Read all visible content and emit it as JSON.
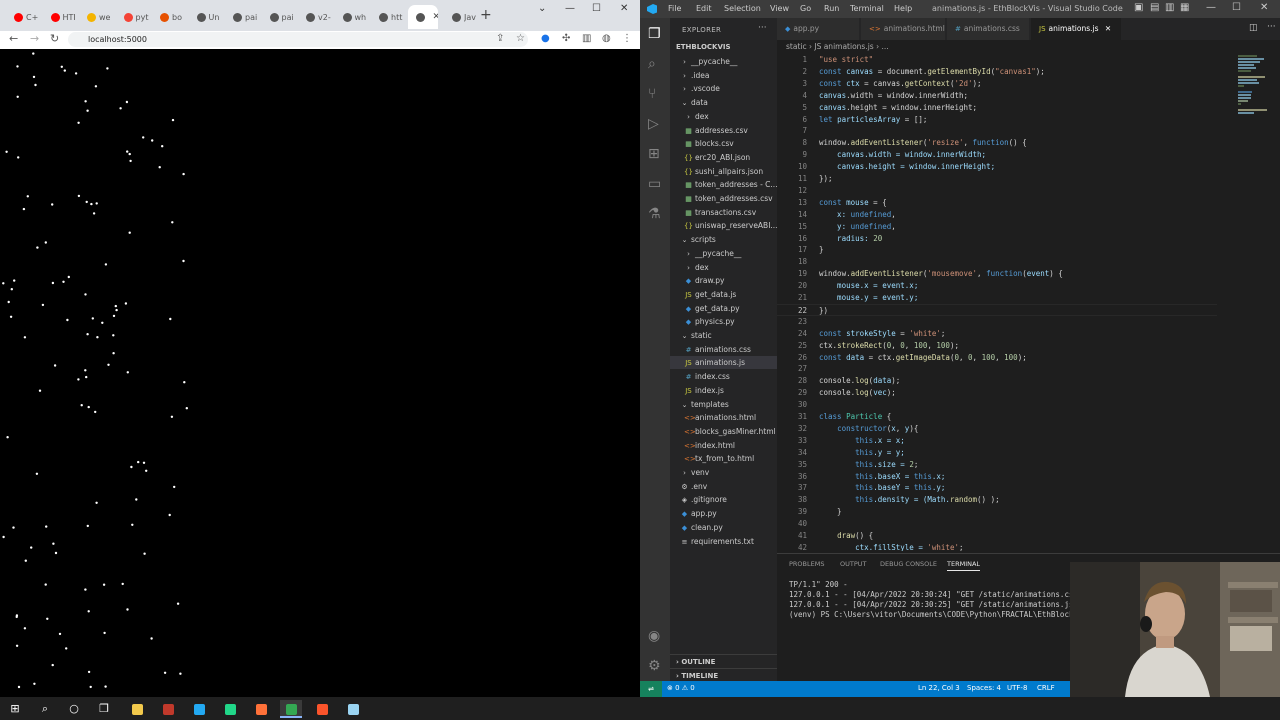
{
  "chrome": {
    "tabs": [
      {
        "label": "C+",
        "color": "#ff0000"
      },
      {
        "label": "HTI",
        "color": "#ff0000"
      },
      {
        "label": "we",
        "color": "#f4b400"
      },
      {
        "label": "pyt",
        "color": "#f44336"
      },
      {
        "label": "bo",
        "color": "#e65100"
      },
      {
        "label": "Un",
        "color": "#555555"
      },
      {
        "label": "pai",
        "color": "#555555"
      },
      {
        "label": "pai",
        "color": "#555555"
      },
      {
        "label": "v2-",
        "color": "#555555"
      },
      {
        "label": "wh",
        "color": "#555555"
      },
      {
        "label": "htt",
        "color": "#555555"
      },
      {
        "label": "",
        "color": "#555555"
      },
      {
        "label": "Jav",
        "color": "#555555"
      }
    ],
    "new_tab_label": "+",
    "url": "localhost:5000"
  },
  "vscode": {
    "menu": [
      "File",
      "Edit",
      "Selection",
      "View",
      "Go",
      "Run",
      "Terminal",
      "Help"
    ],
    "window_title": "animations.js - EthBlockVis - Visual Studio Code",
    "explorer_label": "EXPLORER",
    "root_folder": "ETHBLOCKVIS",
    "tree": [
      {
        "label": "__pycache__",
        "icon": "›",
        "depth": 1,
        "color": "#cccccc"
      },
      {
        "label": ".idea",
        "icon": "›",
        "depth": 1,
        "color": "#cccccc"
      },
      {
        "label": ".vscode",
        "icon": "›",
        "depth": 1,
        "color": "#cccccc"
      },
      {
        "label": "data",
        "icon": "⌄",
        "depth": 1,
        "color": "#cccccc"
      },
      {
        "label": "dex",
        "icon": "›",
        "depth": 2,
        "color": "#cccccc"
      },
      {
        "label": "addresses.csv",
        "icon": "▦",
        "depth": 2,
        "color": "#89d185"
      },
      {
        "label": "blocks.csv",
        "icon": "▦",
        "depth": 2,
        "color": "#89d185"
      },
      {
        "label": "erc20_ABI.json",
        "icon": "{}",
        "depth": 2,
        "color": "#cbcb41"
      },
      {
        "label": "sushi_allpairs.json",
        "icon": "{}",
        "depth": 2,
        "color": "#cbcb41"
      },
      {
        "label": "token_addresses - C...",
        "icon": "▦",
        "depth": 2,
        "color": "#89d185"
      },
      {
        "label": "token_addresses.csv",
        "icon": "▦",
        "depth": 2,
        "color": "#89d185"
      },
      {
        "label": "transactions.csv",
        "icon": "▦",
        "depth": 2,
        "color": "#89d185"
      },
      {
        "label": "uniswap_reserveABI...",
        "icon": "{}",
        "depth": 2,
        "color": "#cbcb41"
      },
      {
        "label": "scripts",
        "icon": "⌄",
        "depth": 1,
        "color": "#cccccc"
      },
      {
        "label": "__pycache__",
        "icon": "›",
        "depth": 2,
        "color": "#cccccc"
      },
      {
        "label": "dex",
        "icon": "›",
        "depth": 2,
        "color": "#cccccc"
      },
      {
        "label": "draw.py",
        "icon": "◆",
        "depth": 2,
        "color": "#3b8fd6"
      },
      {
        "label": "get_data.js",
        "icon": "JS",
        "depth": 2,
        "color": "#cbcb41"
      },
      {
        "label": "get_data.py",
        "icon": "◆",
        "depth": 2,
        "color": "#3b8fd6"
      },
      {
        "label": "physics.py",
        "icon": "◆",
        "depth": 2,
        "color": "#3b8fd6"
      },
      {
        "label": "static",
        "icon": "⌄",
        "depth": 1,
        "color": "#cccccc"
      },
      {
        "label": "animations.css",
        "icon": "#",
        "depth": 2,
        "color": "#519aba"
      },
      {
        "label": "animations.js",
        "icon": "JS",
        "depth": 2,
        "color": "#cbcb41",
        "selected": true
      },
      {
        "label": "index.css",
        "icon": "#",
        "depth": 2,
        "color": "#519aba"
      },
      {
        "label": "index.js",
        "icon": "JS",
        "depth": 2,
        "color": "#cbcb41"
      },
      {
        "label": "templates",
        "icon": "⌄",
        "depth": 1,
        "color": "#cccccc"
      },
      {
        "label": "animations.html",
        "icon": "<>",
        "depth": 2,
        "color": "#e37933"
      },
      {
        "label": "blocks_gasMiner.html",
        "icon": "<>",
        "depth": 2,
        "color": "#e37933"
      },
      {
        "label": "index.html",
        "icon": "<>",
        "depth": 2,
        "color": "#e37933"
      },
      {
        "label": "tx_from_to.html",
        "icon": "<>",
        "depth": 2,
        "color": "#e37933"
      },
      {
        "label": "venv",
        "icon": "›",
        "depth": 1,
        "color": "#cccccc"
      },
      {
        "label": ".env",
        "icon": "⚙",
        "depth": 1,
        "color": "#cccccc"
      },
      {
        "label": ".gitignore",
        "icon": "◈",
        "depth": 1,
        "color": "#cccccc"
      },
      {
        "label": "app.py",
        "icon": "◆",
        "depth": 1,
        "color": "#3b8fd6"
      },
      {
        "label": "clean.py",
        "icon": "◆",
        "depth": 1,
        "color": "#3b8fd6"
      },
      {
        "label": "requirements.txt",
        "icon": "≡",
        "depth": 1,
        "color": "#cccccc"
      }
    ],
    "outline_label": "OUTLINE",
    "timeline_label": "TIMELINE",
    "editor_tabs": [
      {
        "label": "app.py",
        "icon": "◆",
        "color": "#3b8fd6"
      },
      {
        "label": "animations.html",
        "icon": "<>",
        "color": "#e37933"
      },
      {
        "label": "animations.css",
        "icon": "#",
        "color": "#519aba"
      },
      {
        "label": "animations.js",
        "icon": "JS",
        "color": "#cbcb41",
        "active": true
      }
    ],
    "breadcrumb": "static › JS animations.js › ...",
    "code_lines": [
      [
        [
          "\"use strict\"",
          "str"
        ]
      ],
      [
        [
          "const ",
          "kw"
        ],
        [
          "canvas",
          "var"
        ],
        [
          " = document.",
          "pl"
        ],
        [
          "getElementById",
          "fn"
        ],
        [
          "(",
          "pl"
        ],
        [
          "\"canvas1\"",
          "str"
        ],
        [
          ");",
          "pl"
        ]
      ],
      [
        [
          "const ",
          "kw"
        ],
        [
          "ctx",
          "var"
        ],
        [
          " = canvas.",
          "pl"
        ],
        [
          "getContext",
          "fn"
        ],
        [
          "(",
          "pl"
        ],
        [
          "'2d'",
          "str"
        ],
        [
          ");",
          "pl"
        ]
      ],
      [
        [
          "canvas",
          "var"
        ],
        [
          ".width = window.innerWidth;",
          "pl"
        ]
      ],
      [
        [
          "canvas",
          "var"
        ],
        [
          ".height = window.innerHeight;",
          "pl"
        ]
      ],
      [
        [
          "let ",
          "kw"
        ],
        [
          "particlesArray",
          "var"
        ],
        [
          " = [];",
          "pl"
        ]
      ],
      [],
      [
        [
          "window.",
          "pl"
        ],
        [
          "addEventListener",
          "fn"
        ],
        [
          "(",
          "pl"
        ],
        [
          "'resize'",
          "str"
        ],
        [
          ", ",
          "pl"
        ],
        [
          "function",
          "kw"
        ],
        [
          "() {",
          "pl"
        ]
      ],
      [
        [
          "    canvas.width = window.innerWidth;",
          "var"
        ]
      ],
      [
        [
          "    canvas.height = window.innerHeight;",
          "var"
        ]
      ],
      [
        [
          "});",
          "pl"
        ]
      ],
      [],
      [
        [
          "const ",
          "kw"
        ],
        [
          "mouse",
          "var"
        ],
        [
          " = {",
          "pl"
        ]
      ],
      [
        [
          "    x: ",
          "var"
        ],
        [
          "undefined",
          "kw"
        ],
        [
          ",",
          "pl"
        ]
      ],
      [
        [
          "    y: ",
          "var"
        ],
        [
          "undefined",
          "kw"
        ],
        [
          ",",
          "pl"
        ]
      ],
      [
        [
          "    radius: ",
          "var"
        ],
        [
          "20",
          "num"
        ]
      ],
      [
        [
          "}",
          "pl"
        ]
      ],
      [],
      [
        [
          "window.",
          "pl"
        ],
        [
          "addEventListener",
          "fn"
        ],
        [
          "(",
          "pl"
        ],
        [
          "'mousemove'",
          "str"
        ],
        [
          ", ",
          "pl"
        ],
        [
          "function",
          "kw"
        ],
        [
          "(",
          "pl"
        ],
        [
          "event",
          "var"
        ],
        [
          ") {",
          "pl"
        ]
      ],
      [
        [
          "    mouse.x = event.x;",
          "var"
        ]
      ],
      [
        [
          "    mouse.y = event.y;",
          "var"
        ]
      ],
      [
        [
          "})",
          "pl"
        ]
      ],
      [],
      [
        [
          "const ",
          "kw"
        ],
        [
          "strokeStyle",
          "var"
        ],
        [
          " = ",
          "pl"
        ],
        [
          "'white'",
          "str"
        ],
        [
          ";",
          "pl"
        ]
      ],
      [
        [
          "ctx.",
          "pl"
        ],
        [
          "strokeRect",
          "fn"
        ],
        [
          "(",
          "pl"
        ],
        [
          "0",
          "num"
        ],
        [
          ", ",
          "pl"
        ],
        [
          "0",
          "num"
        ],
        [
          ", ",
          "pl"
        ],
        [
          "100",
          "num"
        ],
        [
          ", ",
          "pl"
        ],
        [
          "100",
          "num"
        ],
        [
          ");",
          "pl"
        ]
      ],
      [
        [
          "const ",
          "kw"
        ],
        [
          "data",
          "var"
        ],
        [
          " = ctx.",
          "pl"
        ],
        [
          "getImageData",
          "fn"
        ],
        [
          "(",
          "pl"
        ],
        [
          "0",
          "num"
        ],
        [
          ", ",
          "pl"
        ],
        [
          "0",
          "num"
        ],
        [
          ", ",
          "pl"
        ],
        [
          "100",
          "num"
        ],
        [
          ", ",
          "pl"
        ],
        [
          "100",
          "num"
        ],
        [
          ");",
          "pl"
        ]
      ],
      [],
      [
        [
          "console.",
          "pl"
        ],
        [
          "log",
          "fn"
        ],
        [
          "(",
          "pl"
        ],
        [
          "data",
          "var"
        ],
        [
          ");",
          "pl"
        ]
      ],
      [
        [
          "console.",
          "pl"
        ],
        [
          "log",
          "fn"
        ],
        [
          "(",
          "pl"
        ],
        [
          "vec",
          "var"
        ],
        [
          ");",
          "pl"
        ]
      ],
      [],
      [
        [
          "class ",
          "kw"
        ],
        [
          "Particle",
          "cls"
        ],
        [
          " {",
          "pl"
        ]
      ],
      [
        [
          "    ",
          "pl"
        ],
        [
          "constructor",
          "kw"
        ],
        [
          "(",
          "pl"
        ],
        [
          "x",
          "var"
        ],
        [
          ", ",
          "pl"
        ],
        [
          "y",
          "var"
        ],
        [
          "){",
          "pl"
        ]
      ],
      [
        [
          "        ",
          "pl"
        ],
        [
          "this",
          "kw"
        ],
        [
          ".x = x;",
          "var"
        ]
      ],
      [
        [
          "        ",
          "pl"
        ],
        [
          "this",
          "kw"
        ],
        [
          ".y = y;",
          "var"
        ]
      ],
      [
        [
          "        ",
          "pl"
        ],
        [
          "this",
          "kw"
        ],
        [
          ".size = ",
          "var"
        ],
        [
          "2",
          "num"
        ],
        [
          ";",
          "pl"
        ]
      ],
      [
        [
          "        ",
          "pl"
        ],
        [
          "this",
          "kw"
        ],
        [
          ".baseX = ",
          "var"
        ],
        [
          "this",
          "kw"
        ],
        [
          ".x;",
          "var"
        ]
      ],
      [
        [
          "        ",
          "pl"
        ],
        [
          "this",
          "kw"
        ],
        [
          ".baseY = ",
          "var"
        ],
        [
          "this",
          "kw"
        ],
        [
          ".y;",
          "var"
        ]
      ],
      [
        [
          "        ",
          "pl"
        ],
        [
          "this",
          "kw"
        ],
        [
          ".density = (Math.",
          "var"
        ],
        [
          "random",
          "fn"
        ],
        [
          "() ",
          "pl"
        ],
        [
          ");",
          "pl"
        ]
      ],
      [
        [
          "    }",
          "pl"
        ]
      ],
      [],
      [
        [
          "    ",
          "pl"
        ],
        [
          "draw",
          "fn"
        ],
        [
          "() {",
          "pl"
        ]
      ],
      [
        [
          "        ctx.fillStyle = ",
          "var"
        ],
        [
          "'white'",
          "str"
        ],
        [
          ";",
          "pl"
        ]
      ]
    ],
    "current_line": 22,
    "panel_tabs": [
      "PROBLEMS",
      "OUTPUT",
      "DEBUG CONSOLE",
      "TERMINAL"
    ],
    "terminal_lines": [
      "TP/1.1\" 200 -",
      "127.0.0.1 - - [04/Apr/2022 20:30:24] \"GET /static/animations.css",
      "127.0.0.1 - - [04/Apr/2022 20:30:25] \"GET /static/animations.js",
      "(venv) PS C:\\Users\\vitor\\Documents\\CODE\\Python\\FRACTAL\\EthBlock"
    ],
    "status": {
      "errors": "⊗ 0 ⚠ 0",
      "position": "Ln 22, Col 3",
      "spaces": "Spaces: 4",
      "encoding": "UTF-8",
      "eol": "CRLF"
    }
  },
  "taskbar": {
    "items": [
      {
        "name": "start-button",
        "glyph": "⊞",
        "color": "#ffffff"
      },
      {
        "name": "search-button",
        "glyph": "⌕",
        "color": "#ffffff"
      },
      {
        "name": "cortana-button",
        "glyph": "○",
        "color": "#ffffff"
      },
      {
        "name": "task-view-button",
        "glyph": "❐",
        "color": "#ffffff"
      },
      {
        "name": "file-explorer-button",
        "glyph": "",
        "color": "#f2c94c"
      },
      {
        "name": "app-button",
        "glyph": "",
        "color": "#c0392b"
      },
      {
        "name": "vscode-button",
        "glyph": "",
        "color": "#23a9f2"
      },
      {
        "name": "pycharm-button",
        "glyph": "",
        "color": "#21d789"
      },
      {
        "name": "firefox-button",
        "glyph": "",
        "color": "#ff7139"
      },
      {
        "name": "chrome-button",
        "glyph": "",
        "color": "#34a853",
        "active": true
      },
      {
        "name": "brave-button",
        "glyph": "",
        "color": "#fb542b"
      },
      {
        "name": "notes-button",
        "glyph": "",
        "color": "#9ad4f2"
      }
    ]
  },
  "colors": {
    "accent": "#007acc",
    "editor_bg": "#1e1e1e",
    "sidebar_bg": "#252526",
    "activity_bg": "#333333"
  }
}
